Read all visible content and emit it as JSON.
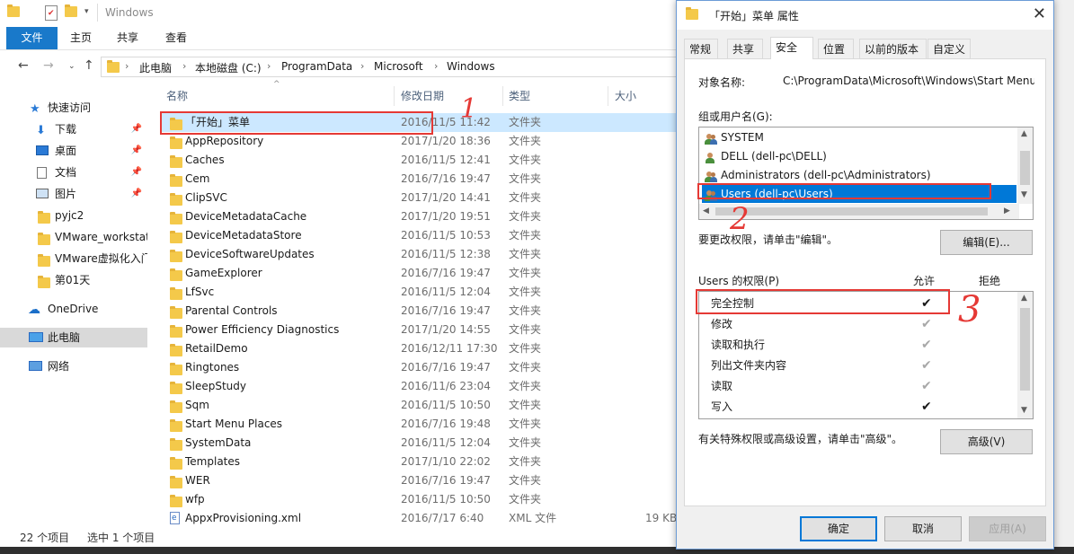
{
  "explorer": {
    "title": "Windows",
    "ribbon_tabs": [
      "文件",
      "主页",
      "共享",
      "查看"
    ],
    "breadcrumb": [
      "此电脑",
      "本地磁盘 (C:)",
      "ProgramData",
      "Microsoft",
      "Windows"
    ],
    "nav": [
      {
        "label": "快速访问",
        "icon": "star-icon",
        "pinned": false
      },
      {
        "label": "下载",
        "icon": "download-icon",
        "pinned": true
      },
      {
        "label": "桌面",
        "icon": "desktop-icon",
        "pinned": true
      },
      {
        "label": "文档",
        "icon": "document-icon",
        "pinned": true
      },
      {
        "label": "图片",
        "icon": "picture-icon",
        "pinned": true
      },
      {
        "label": "pyjc2",
        "icon": "folder-icon",
        "pinned": false
      },
      {
        "label": "VMware_workstat",
        "icon": "folder-icon",
        "pinned": false
      },
      {
        "label": "VMware虚拟化入门",
        "icon": "folder-icon",
        "pinned": false
      },
      {
        "label": "第01天",
        "icon": "folder-icon",
        "pinned": false
      },
      {
        "label": "OneDrive",
        "icon": "cloud-icon",
        "pinned": false
      },
      {
        "label": "此电脑",
        "icon": "computer-icon",
        "pinned": false
      },
      {
        "label": "网络",
        "icon": "network-icon",
        "pinned": false
      }
    ],
    "columns": {
      "name": "名称",
      "date": "修改日期",
      "type": "类型",
      "size": "大小"
    },
    "files": [
      {
        "name": "「开始」菜单",
        "date": "2016/11/5 11:42",
        "type": "文件夹",
        "size": ""
      },
      {
        "name": "AppRepository",
        "date": "2017/1/20 18:36",
        "type": "文件夹",
        "size": ""
      },
      {
        "name": "Caches",
        "date": "2016/11/5 12:41",
        "type": "文件夹",
        "size": ""
      },
      {
        "name": "Cem",
        "date": "2016/7/16 19:47",
        "type": "文件夹",
        "size": ""
      },
      {
        "name": "ClipSVC",
        "date": "2017/1/20 14:41",
        "type": "文件夹",
        "size": ""
      },
      {
        "name": "DeviceMetadataCache",
        "date": "2017/1/20 19:51",
        "type": "文件夹",
        "size": ""
      },
      {
        "name": "DeviceMetadataStore",
        "date": "2016/11/5 10:53",
        "type": "文件夹",
        "size": ""
      },
      {
        "name": "DeviceSoftwareUpdates",
        "date": "2016/11/5 12:38",
        "type": "文件夹",
        "size": ""
      },
      {
        "name": "GameExplorer",
        "date": "2016/7/16 19:47",
        "type": "文件夹",
        "size": ""
      },
      {
        "name": "LfSvc",
        "date": "2016/11/5 12:04",
        "type": "文件夹",
        "size": ""
      },
      {
        "name": "Parental Controls",
        "date": "2016/7/16 19:47",
        "type": "文件夹",
        "size": ""
      },
      {
        "name": "Power Efficiency Diagnostics",
        "date": "2017/1/20 14:55",
        "type": "文件夹",
        "size": ""
      },
      {
        "name": "RetailDemo",
        "date": "2016/12/11 17:30",
        "type": "文件夹",
        "size": ""
      },
      {
        "name": "Ringtones",
        "date": "2016/7/16 19:47",
        "type": "文件夹",
        "size": ""
      },
      {
        "name": "SleepStudy",
        "date": "2016/11/6 23:04",
        "type": "文件夹",
        "size": ""
      },
      {
        "name": "Sqm",
        "date": "2016/11/5 10:50",
        "type": "文件夹",
        "size": ""
      },
      {
        "name": "Start Menu Places",
        "date": "2016/7/16 19:48",
        "type": "文件夹",
        "size": ""
      },
      {
        "name": "SystemData",
        "date": "2016/11/5 12:04",
        "type": "文件夹",
        "size": ""
      },
      {
        "name": "Templates",
        "date": "2017/1/10 22:02",
        "type": "文件夹",
        "size": ""
      },
      {
        "name": "WER",
        "date": "2016/7/16 19:47",
        "type": "文件夹",
        "size": ""
      },
      {
        "name": "wfp",
        "date": "2016/11/5 10:50",
        "type": "文件夹",
        "size": ""
      },
      {
        "name": "AppxProvisioning.xml",
        "date": "2016/7/17 6:40",
        "type": "XML 文件",
        "size": "19 KB"
      }
    ],
    "status": {
      "count": "22 个项目",
      "selected": "选中 1 个项目"
    }
  },
  "dialog": {
    "title": "「开始」菜单 属性",
    "tabs": [
      "常规",
      "共享",
      "安全",
      "位置",
      "以前的版本",
      "自定义"
    ],
    "active_tab": "安全",
    "object_label": "对象名称:",
    "object_value": "C:\\ProgramData\\Microsoft\\Windows\\Start Menu",
    "groups_label": "组或用户名(G):",
    "groups": [
      {
        "name": "SYSTEM"
      },
      {
        "name": "DELL (dell-pc\\DELL)"
      },
      {
        "name": "Administrators (dell-pc\\Administrators)"
      },
      {
        "name": "Users (dell-pc\\Users)"
      }
    ],
    "edit_hint": "要更改权限，请单击\"编辑\"。",
    "edit_button": "编辑(E)...",
    "perm_label": "Users 的权限(P)",
    "allow_label": "允许",
    "deny_label": "拒绝",
    "permissions": [
      {
        "name": "完全控制",
        "allow": "✔",
        "inherited": false
      },
      {
        "name": "修改",
        "allow": "✔",
        "inherited": true
      },
      {
        "name": "读取和执行",
        "allow": "✔",
        "inherited": true
      },
      {
        "name": "列出文件夹内容",
        "allow": "✔",
        "inherited": true
      },
      {
        "name": "读取",
        "allow": "✔",
        "inherited": true
      },
      {
        "name": "写入",
        "allow": "✔",
        "inherited": false
      }
    ],
    "advanced_hint": "有关特殊权限或高级设置，请单击\"高级\"。",
    "advanced_button": "高级(V)",
    "ok_button": "确定",
    "cancel_button": "取消",
    "apply_button": "应用(A)"
  },
  "annotations": {
    "n1": "1",
    "n2": "2",
    "n3": "3",
    "color": "#e53935"
  }
}
